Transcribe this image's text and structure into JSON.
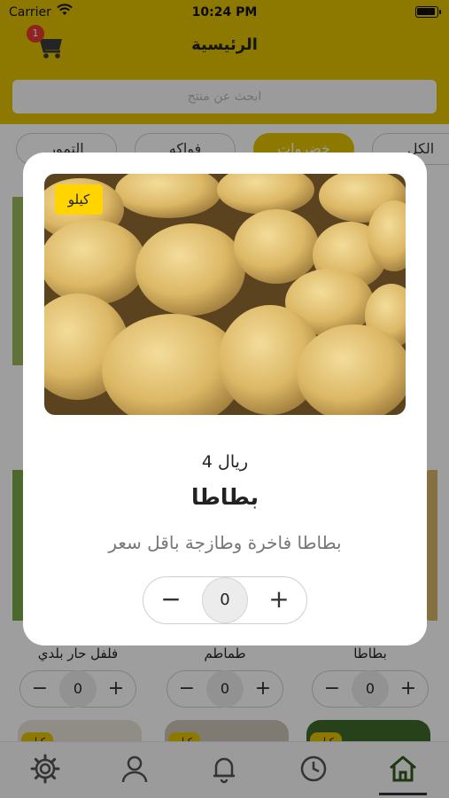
{
  "status_bar": {
    "carrier": "Carrier",
    "time": "10:24 PM"
  },
  "header": {
    "title": "الرئيسية",
    "cart_count": "1"
  },
  "search": {
    "placeholder": "ابحث عن منتج"
  },
  "categories": [
    {
      "label": "الكل",
      "active": false
    },
    {
      "label": "خضروات",
      "active": true
    },
    {
      "label": "فواكه",
      "active": false
    },
    {
      "label": "التمور",
      "active": false
    }
  ],
  "grid": {
    "items": [
      {
        "name": "بطاطا",
        "quantity": "0",
        "unit": "كيلو"
      },
      {
        "name": "طماطم",
        "quantity": "0",
        "unit": "كيلو"
      },
      {
        "name": "فلفل حار بلدي",
        "quantity": "0",
        "unit": "كيلو"
      }
    ]
  },
  "modal": {
    "unit": "كيلو",
    "price": "4 ريال",
    "name": "بطاطا",
    "description": "بطاطا فاخرة وطازجة باقل سعر",
    "quantity": "0",
    "minus": "−",
    "plus": "+"
  },
  "tabbar": {
    "items": [
      {
        "icon": "home-icon",
        "active": true
      },
      {
        "icon": "history-icon",
        "active": false
      },
      {
        "icon": "bell-icon",
        "active": false
      },
      {
        "icon": "user-icon",
        "active": false
      },
      {
        "icon": "gear-icon",
        "active": false
      }
    ]
  },
  "colors": {
    "brand": "#e6c300",
    "badge": "#e53935",
    "tag": "#ffd400"
  }
}
